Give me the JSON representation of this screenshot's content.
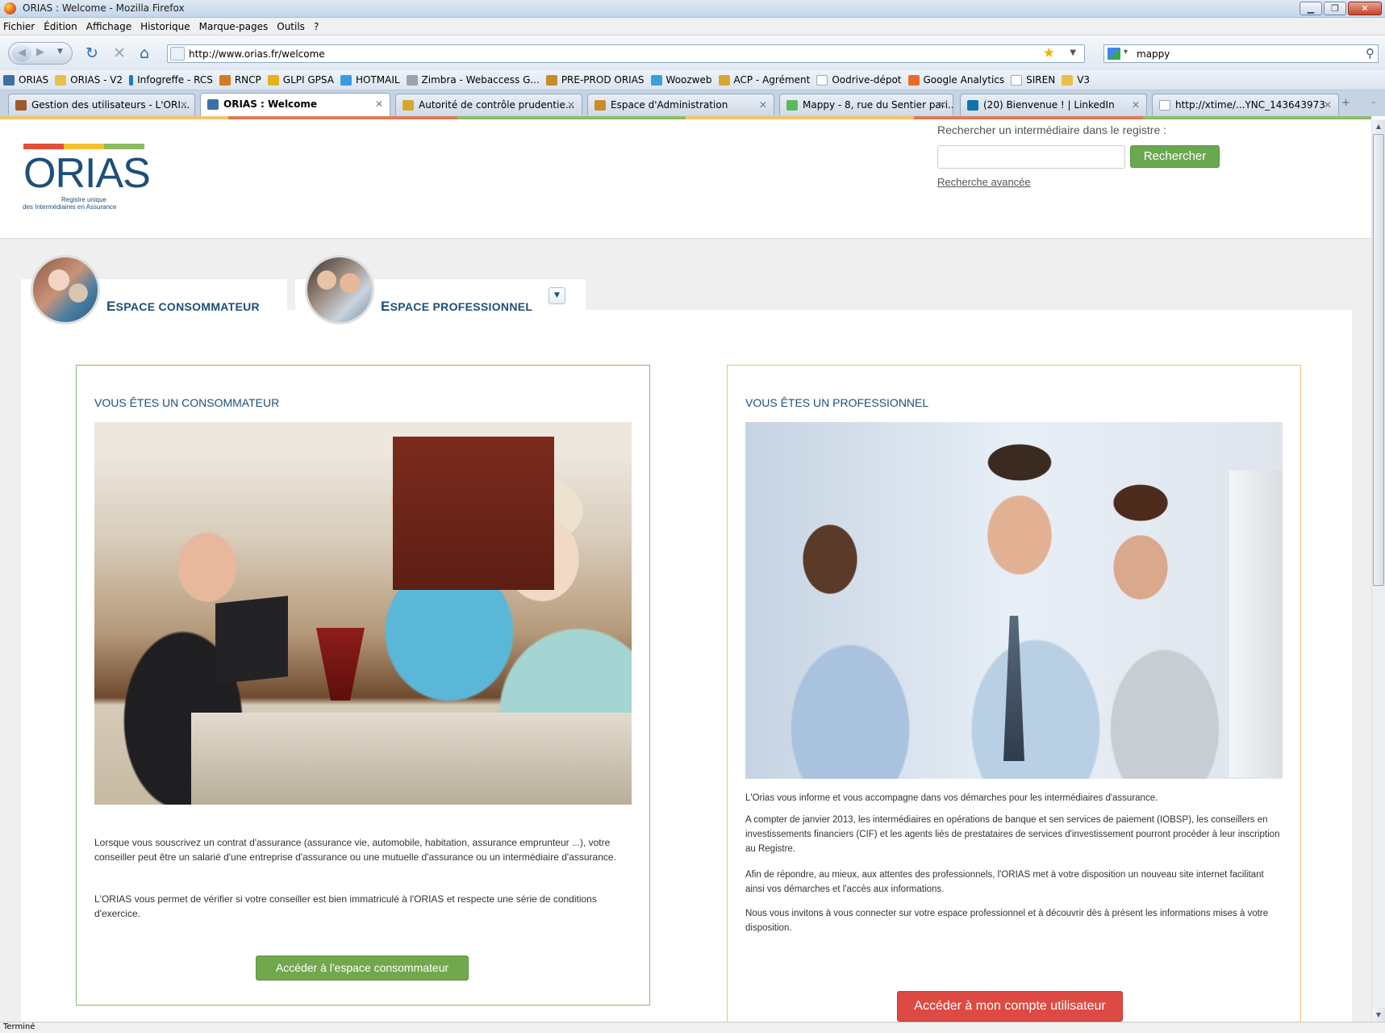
{
  "window": {
    "title": "ORIAS : Welcome - Mozilla Firefox"
  },
  "menu": [
    "Fichier",
    "Édition",
    "Affichage",
    "Historique",
    "Marque-pages",
    "Outils",
    "?"
  ],
  "nav": {
    "url": "http://www.orias.fr/welcome",
    "search_value": "mappy"
  },
  "bookmarks": [
    {
      "label": "ORIAS",
      "color": "#3d6fa8"
    },
    {
      "label": "ORIAS - V2",
      "color": "#e8c04a"
    },
    {
      "label": "Infogreffe - RCS",
      "color": "#1e7bc4"
    },
    {
      "label": "RNCP",
      "color": "#d77a22"
    },
    {
      "label": "GLPI GPSA",
      "color": "#e8b020"
    },
    {
      "label": "HOTMAIL",
      "color": "#3b9be0"
    },
    {
      "label": "Zimbra - Webaccess G...",
      "color": "#9aa3ad"
    },
    {
      "label": "PRE-PROD ORIAS",
      "color": "#c98b2c"
    },
    {
      "label": "Woozweb",
      "color": "#3aa0d8"
    },
    {
      "label": "ACP - Agrément",
      "color": "#d6a830"
    },
    {
      "label": "Oodrive-dépot",
      "color": "#e6e9ee"
    },
    {
      "label": "Google Analytics",
      "color": "#e96b28"
    },
    {
      "label": "SIREN",
      "color": "#e6e9ee"
    },
    {
      "label": "V3",
      "color": "#e8c04a"
    }
  ],
  "tabs": [
    {
      "label": "Gestion des utilisateurs - L'ORI...",
      "color": "#a05a2c"
    },
    {
      "label": "ORIAS : Welcome",
      "color": "#3d6fa8"
    },
    {
      "label": "Autorité de contrôle prudentie...",
      "color": "#d6a830"
    },
    {
      "label": "Espace d'Administration",
      "color": "#c98b2c"
    },
    {
      "label": "Mappy - 8, rue du Sentier pari...",
      "color": "#5cb85c"
    },
    {
      "label": "(20) Bienvenue ! | LinkedIn",
      "color": "#0e76a8"
    },
    {
      "label": "http://xtime/...YNC_143643973",
      "color": "#e6e9ee"
    }
  ],
  "header": {
    "logo_name": "ORIAS",
    "logo_sub1": "Registre unique",
    "logo_sub2": "des Intermédiaires en Assurance",
    "search_label": "Rechercher un intermédiaire dans le registre :",
    "search_button": "Rechercher",
    "advanced_link": "Recherche avancée"
  },
  "spaces": {
    "consumer_first": "E",
    "consumer_rest": "SPACE CONSOMMATEUR",
    "pro_first": "E",
    "pro_rest": "SPACE PROFESSIONNEL"
  },
  "consumer_card": {
    "title": "VOUS ÊTES UN CONSOMMATEUR",
    "p1": "Lorsque vous souscrivez un contrat d'assurance (assurance vie, automobile, habitation, assurance emprunteur ...), votre conseiller peut être un salarié d'une entreprise d'assurance ou une mutuelle d'assurance ou un intermédiaire d'assurance.",
    "p2": "L'ORIAS vous permet de vérifier si votre conseiller est bien immatriculé à l'ORIAS et respecte une série de conditions d'exercice.",
    "button": "Accéder à l'espace consommateur"
  },
  "pro_card": {
    "title": "VOUS ÊTES UN PROFESSIONNEL",
    "p1": "L'Orias vous informe et vous accompagne dans vos démarches pour les intermédiaires d'assurance.",
    "p2": "A compter de janvier 2013, les intermédiaires en opérations de banque et sen services de paiement (IOBSP), les conseillers en investissements financiers (CIF) et les agents liés de prestataires de services d'investissement pourront procéder à leur inscription au Registre.",
    "p3": "Afin de répondre, au mieux, aux attentes des professionnels, l'ORIAS met à votre disposition un nouveau site internet facilitant ainsi vos démarches et l'accès aux informations.",
    "p4": "Nous vous invitons à vous connecter sur votre espace professionnel et à découvrir dès à présent les informations mises à votre disposition.",
    "button": "Accéder à mon compte utilisateur"
  },
  "status": "Terminé"
}
